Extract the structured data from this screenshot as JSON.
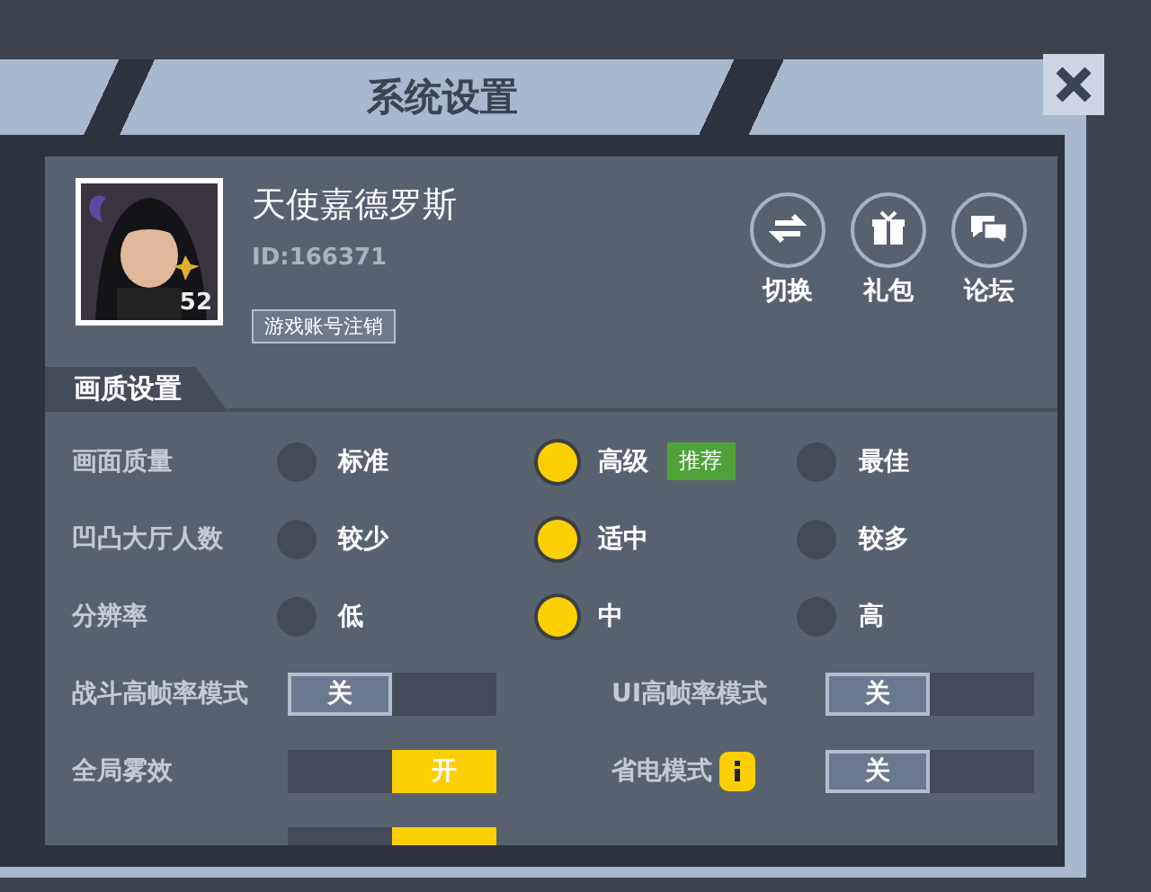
{
  "window": {
    "title": "系统设置"
  },
  "profile": {
    "name": "天使嘉德罗斯",
    "id": "ID:166371",
    "level": "52",
    "cancel_button": "游戏账号注销"
  },
  "actions": [
    {
      "kind": "switch",
      "label": "切换"
    },
    {
      "kind": "gift",
      "label": "礼包"
    },
    {
      "kind": "forum",
      "label": "论坛"
    }
  ],
  "section": {
    "title": "画质设置"
  },
  "radio_rows": [
    {
      "label": "画面质量",
      "options": [
        {
          "label": "标准",
          "selected": false
        },
        {
          "label": "高级",
          "selected": true,
          "badge": "推荐"
        },
        {
          "label": "最佳",
          "selected": false
        }
      ]
    },
    {
      "label": "凹凸大厅人数",
      "options": [
        {
          "label": "较少",
          "selected": false
        },
        {
          "label": "适中",
          "selected": true
        },
        {
          "label": "较多",
          "selected": false
        }
      ]
    },
    {
      "label": "分辨率",
      "options": [
        {
          "label": "低",
          "selected": false
        },
        {
          "label": "中",
          "selected": true
        },
        {
          "label": "高",
          "selected": false
        }
      ]
    }
  ],
  "toggles": [
    {
      "label": "战斗高帧率模式",
      "on": false,
      "text": "关"
    },
    {
      "label": "UI高帧率模式",
      "on": false,
      "text": "关"
    },
    {
      "label": "全局雾效",
      "on": true,
      "text": "开"
    },
    {
      "label": "省电模式",
      "info": true,
      "on": false,
      "text": "关"
    },
    {
      "on": true
    }
  ]
}
